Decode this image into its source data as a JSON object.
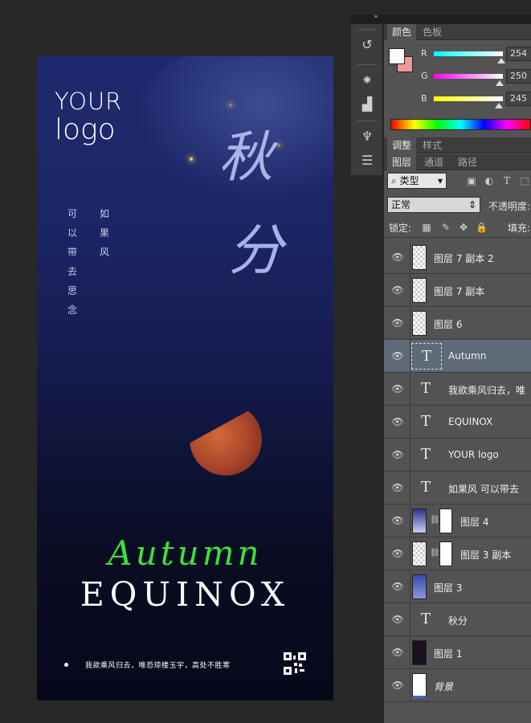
{
  "panels": {
    "color_tabs": [
      "颜色",
      "色板"
    ],
    "adjust_tabs": [
      "调整",
      "样式"
    ],
    "layer_tabs": [
      "图层",
      "通道",
      "路径"
    ]
  },
  "color": {
    "foreground": "#fefafa",
    "background": "#f09a98",
    "r_label": "R",
    "g_label": "G",
    "b_label": "B",
    "r": "254",
    "g": "250",
    "b": "245"
  },
  "layers_panel": {
    "filter_kind": "类型",
    "blend_mode": "正常",
    "opacity_label": "不透明度:",
    "lock_label": "锁定:",
    "fill_label": "填充:",
    "layers": [
      {
        "name": "图层 7 副本 2",
        "kind": "pixel"
      },
      {
        "name": "图层 7 副本",
        "kind": "pixel"
      },
      {
        "name": "图层 6",
        "kind": "pixel"
      },
      {
        "name": "Autumn",
        "kind": "text",
        "selected": true
      },
      {
        "name": "我欲乘风归去，唯",
        "kind": "text"
      },
      {
        "name": "EQUINOX",
        "kind": "text"
      },
      {
        "name": "YOUR  logo",
        "kind": "text"
      },
      {
        "name": "如果风  可以带去",
        "kind": "text"
      },
      {
        "name": "图层 4",
        "kind": "masked"
      },
      {
        "name": "图层 3 副本",
        "kind": "masked"
      },
      {
        "name": "图层 3",
        "kind": "gradient"
      },
      {
        "name": "秋分",
        "kind": "text"
      },
      {
        "name": "图层 1",
        "kind": "dark"
      },
      {
        "name": "背景",
        "kind": "background"
      }
    ]
  },
  "poster": {
    "logo_line1": "YOUR",
    "logo_line2": "logo",
    "calligraphy_1": "秋",
    "calligraphy_2": "分",
    "poem_col1": [
      "可",
      "以",
      "带",
      "去",
      "思",
      "念"
    ],
    "poem_col2": [
      "如",
      "果",
      "风"
    ],
    "autumn": "Autumn",
    "equinox": "EQUINOX",
    "bottom_line": "我欲乘风归去，唯恐琼楼玉宇，高处不胜寒"
  }
}
